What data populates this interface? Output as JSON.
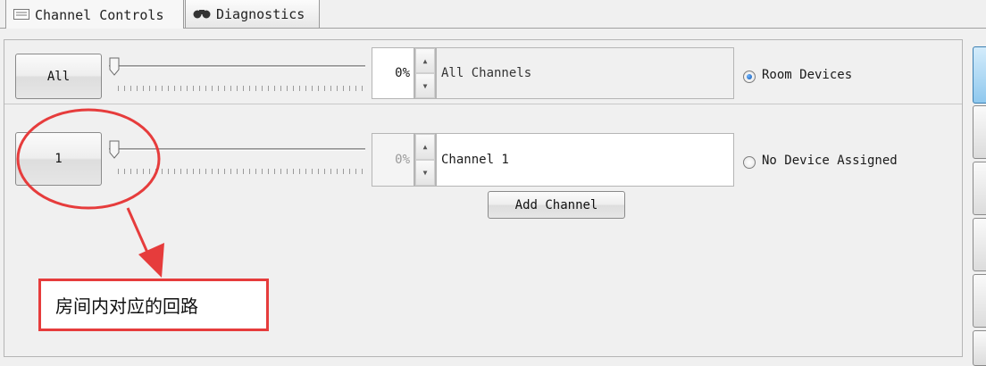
{
  "tabs": [
    {
      "label": "Channel Controls",
      "icon": "list-icon"
    },
    {
      "label": "Diagnostics",
      "icon": "binoculars-icon"
    }
  ],
  "rows": [
    {
      "button_label": "All",
      "percent": "0%",
      "name": "All Channels",
      "radio_label": "Room Devices",
      "radio_selected": true
    },
    {
      "button_label": "1",
      "percent": "0%",
      "name": "Channel 1",
      "radio_label": "No Device Assigned",
      "radio_selected": false
    }
  ],
  "add_channel_label": "Add Channel",
  "annotation": {
    "text": "房间内对应的回路",
    "color": "#e63c3c"
  },
  "colors": {
    "accent": "#e63c3c",
    "radio_selected": "#1565c0"
  }
}
